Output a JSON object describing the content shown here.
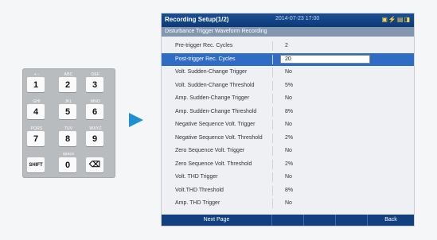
{
  "keypad": {
    "keys": [
      {
        "label": "1",
        "sub": "+ -"
      },
      {
        "label": "2",
        "sub": "ABC"
      },
      {
        "label": "3",
        "sub": "DEF"
      },
      {
        "label": "4",
        "sub": "GHI"
      },
      {
        "label": "5",
        "sub": "JKL"
      },
      {
        "label": "6",
        "sub": "MNO"
      },
      {
        "label": "7",
        "sub": "PQRS"
      },
      {
        "label": "8",
        "sub": "TUV"
      },
      {
        "label": "9",
        "sub": "WXYZ"
      },
      {
        "label": "SHIFT",
        "sub": ""
      },
      {
        "label": "0",
        "sub": "space"
      },
      {
        "label": "⌫",
        "sub": ""
      }
    ]
  },
  "screen": {
    "title": "Recording Setup(1/2)",
    "time": "2014-07-23 17:00",
    "status_icons": "▣⚡▤◨",
    "subtitle": "Disturbance Trigger Waveform Recording",
    "rows": [
      {
        "label": "Pre-trigger Rec. Cycles",
        "value": "2"
      },
      {
        "label": "Post-trigger Rec. Cycles",
        "value": "20",
        "selected": true
      },
      {
        "label": "Volt. Sudden-Change Trigger",
        "value": "No"
      },
      {
        "label": "Volt. Sudden-Change Threshold",
        "value": "5%"
      },
      {
        "label": "Amp. Sudden-Change Trigger",
        "value": "No"
      },
      {
        "label": "Amp. Sudden-Change Threshold",
        "value": "8%"
      },
      {
        "label": "Negative Sequence Volt. Trigger",
        "value": "No"
      },
      {
        "label": "Negative Sequence Volt. Threshold",
        "value": "2%"
      },
      {
        "label": "Zero Sequence Volt. Trigger",
        "value": "No"
      },
      {
        "label": "Zero Sequence Volt. Threshold",
        "value": "2%"
      },
      {
        "label": "Volt. THD Trigger",
        "value": "No"
      },
      {
        "label": "Volt.THD Threshold",
        "value": "8%"
      },
      {
        "label": "Amp. THD Trigger",
        "value": "No"
      }
    ],
    "softkeys": [
      "Next Page",
      "",
      "",
      "",
      "Back"
    ]
  }
}
